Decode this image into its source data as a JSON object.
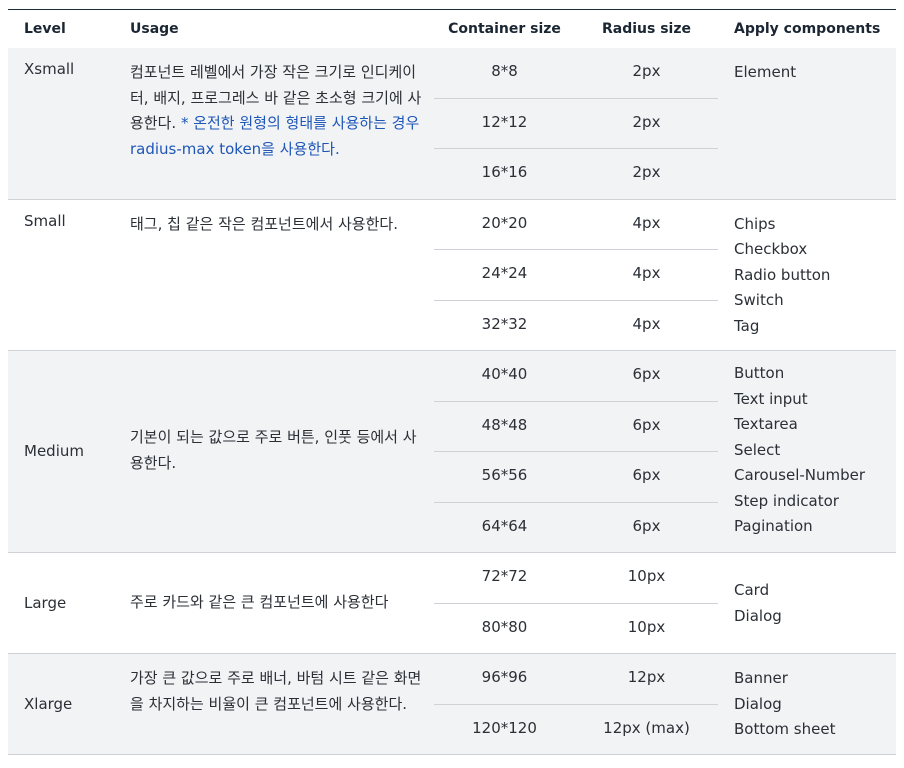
{
  "headers": {
    "level": "Level",
    "usage": "Usage",
    "container": "Container size",
    "radius": "Radius size",
    "apply": "Apply components"
  },
  "rows": [
    {
      "level": "Xsmall",
      "usage": "컴포넌트 레벨에서 가장 작은 크기로 인디케이터, 배지, 프로그레스 바 같은 초소형 크기에 사용한다. ",
      "note": "* 온전한 원형의 형태를 사용하는 경우 radius-max token을 사용한다.",
      "sizes": [
        {
          "container": "8*8",
          "radius": "2px"
        },
        {
          "container": "12*12",
          "radius": "2px"
        },
        {
          "container": "16*16",
          "radius": "2px"
        }
      ],
      "components": [
        "Element"
      ]
    },
    {
      "level": "Small",
      "usage": "태그, 칩 같은 작은 컴포넌트에서 사용한다.",
      "note": "",
      "sizes": [
        {
          "container": "20*20",
          "radius": "4px"
        },
        {
          "container": "24*24",
          "radius": "4px"
        },
        {
          "container": "32*32",
          "radius": "4px"
        }
      ],
      "components": [
        "Chips",
        "Checkbox",
        "Radio button",
        "Switch",
        "Tag"
      ]
    },
    {
      "level": "Medium",
      "usage": "기본이 되는 값으로 주로 버튼, 인풋 등에서 사용한다.",
      "note": "",
      "sizes": [
        {
          "container": "40*40",
          "radius": "6px"
        },
        {
          "container": "48*48",
          "radius": "6px"
        },
        {
          "container": "56*56",
          "radius": "6px"
        },
        {
          "container": "64*64",
          "radius": "6px"
        }
      ],
      "components": [
        "Button",
        "Text input",
        "Textarea",
        "Select",
        "Carousel-Number",
        "Step indicator",
        "Pagination"
      ]
    },
    {
      "level": "Large",
      "usage": "주로 카드와 같은 큰 컴포넌트에 사용한다",
      "note": "",
      "sizes": [
        {
          "container": "72*72",
          "radius": "10px"
        },
        {
          "container": "80*80",
          "radius": "10px"
        }
      ],
      "components": [
        "Card",
        "Dialog"
      ]
    },
    {
      "level": "Xlarge",
      "usage": "가장 큰 값으로 주로 배너, 바텀 시트 같은 화면을 차지하는 비율이 큰 컴포넌트에 사용한다.",
      "note": "",
      "sizes": [
        {
          "container": "96*96",
          "radius": "12px"
        },
        {
          "container": "120*120",
          "radius": "12px (max)"
        }
      ],
      "components": [
        "Banner",
        "Dialog",
        "Bottom sheet"
      ]
    }
  ]
}
